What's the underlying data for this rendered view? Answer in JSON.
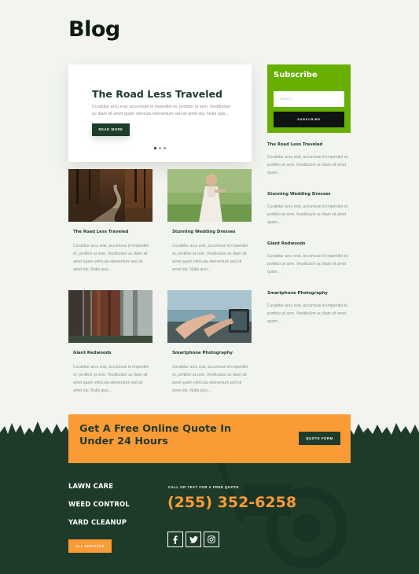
{
  "page": {
    "title": "Blog"
  },
  "featured": {
    "title": "The Road Less Traveled",
    "excerpt": "Curabitur arcu erat, accumsan id imperdiet et, porttitor at sem. Vestibulum ac diam sit amet quam vehicula elementum sed sit amet dui. Nulla quis...",
    "read_more": "READ MORE",
    "slides": 3,
    "active_slide": 1
  },
  "subscribe": {
    "title": "Subscribe",
    "email_placeholder": "EMAIL",
    "button": "SUBSCRIBE"
  },
  "sidebar_posts": [
    {
      "title": "The Road Less Traveled",
      "excerpt": "Curabitur arcu erat, accumsan id imperdiet et, porttitor at sem. Vestibulum ac diam sit amet quam..."
    },
    {
      "title": "Stunning Wedding Dresses",
      "excerpt": "Curabitur arcu erat, accumsan id imperdiet et, porttitor at sem. Vestibulum ac diam sit amet quam..."
    },
    {
      "title": "Giant Redwoods",
      "excerpt": "Curabitur arcu erat, accumsan id imperdiet et, porttitor at sem. Vestibulum ac diam sit amet quam..."
    },
    {
      "title": "Smartphone Photography",
      "excerpt": "Curabitur arcu erat, accumsan id imperdiet et, porttitor at sem. Vestibulum ac diam sit amet quam..."
    }
  ],
  "posts": [
    {
      "title": "The Road Less Traveled",
      "excerpt": "Curabitur arcu erat, accumsan id imperdiet et, porttitor at sem. Vestibulum ac diam sit amet quam vehicula elementum sed sit amet dui. Nulla quis..."
    },
    {
      "title": "Stunning Wedding Dresses",
      "excerpt": "Curabitur arcu erat, accumsan id imperdiet et, porttitor at sem. Vestibulum ac diam sit amet quam vehicula elementum sed sit amet dui. Nulla quis..."
    },
    {
      "title": "Giant Redwoods",
      "excerpt": "Curabitur arcu erat, accumsan id imperdiet et, porttitor at sem. Vestibulum ac diam sit amet quam vehicula elementum sed sit amet dui. Nulla quis..."
    },
    {
      "title": "Smartphone Photography",
      "excerpt": "Curabitur arcu erat, accumsan id imperdiet et, porttitor at sem. Vestibulum ac diam sit amet quam vehicula elementum sed sit amet dui. Nulla quis..."
    }
  ],
  "cta": {
    "heading": "Get A Free Online Quote In Under 24 Hours",
    "button": "QUOTE FORM"
  },
  "footer": {
    "services": [
      "LAWN CARE",
      "WEED CONTROL",
      "YARD CLEANUP"
    ],
    "all_services": "ALL SERVICES",
    "call_label": "CALL OR TEXT FOR A FREE QUOTE",
    "phone": "(255) 352-6258",
    "social_icons": [
      "facebook-icon",
      "twitter-icon",
      "instagram-icon"
    ]
  },
  "colors": {
    "accent_orange": "#fb9b35",
    "subscribe_green": "#68b000",
    "dark_green": "#1e3b2a",
    "background": "#f1f4ef"
  }
}
